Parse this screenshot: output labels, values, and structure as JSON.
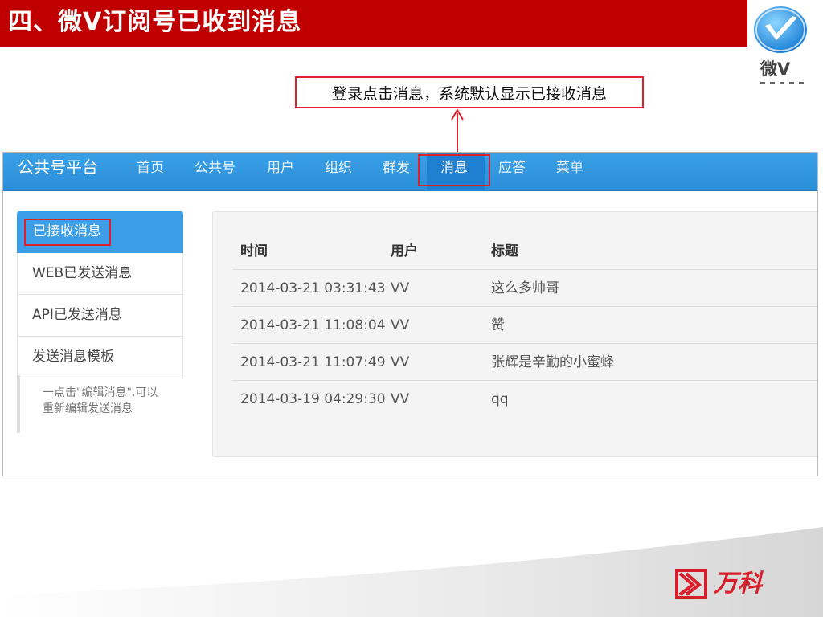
{
  "slide": {
    "title": "四、微V订阅号已收到消息",
    "callout": "登录点击消息，系统默认显示已接收消息"
  },
  "logo": {
    "text": "微V",
    "company": "万科"
  },
  "colors": {
    "header_red": "#c00000",
    "nav_blue": "#2f95e0",
    "highlight_red": "#e0202a",
    "vanke_red": "#d81e2a"
  },
  "app": {
    "brand": "公共号平台",
    "nav": [
      {
        "label": "首页",
        "active": false
      },
      {
        "label": "公共号",
        "active": false
      },
      {
        "label": "用户",
        "active": false
      },
      {
        "label": "组织",
        "active": false
      },
      {
        "label": "群发",
        "active": false
      },
      {
        "label": "消息",
        "active": true
      },
      {
        "label": "应答",
        "active": false
      },
      {
        "label": "菜单",
        "active": false
      }
    ],
    "sidebar": {
      "items": [
        {
          "label": "已接收消息",
          "active": true
        },
        {
          "label": "WEB已发送消息",
          "active": false
        },
        {
          "label": "API已发送消息",
          "active": false
        },
        {
          "label": "发送消息模板",
          "active": false
        }
      ],
      "note": "一点击\"编辑消息\",可以重新编辑发送消息"
    },
    "table": {
      "headers": [
        "时间",
        "用户",
        "标题"
      ],
      "rows": [
        {
          "time": "2014-03-21 03:31:43",
          "user": "VV",
          "title": "这么多帅哥"
        },
        {
          "time": "2014-03-21 11:08:04",
          "user": "VV",
          "title": "赞"
        },
        {
          "time": "2014-03-21 11:07:49",
          "user": "VV",
          "title": "张辉是辛勤的小蜜蜂"
        },
        {
          "time": "2014-03-19 04:29:30",
          "user": "VV",
          "title": "qq"
        }
      ]
    }
  }
}
